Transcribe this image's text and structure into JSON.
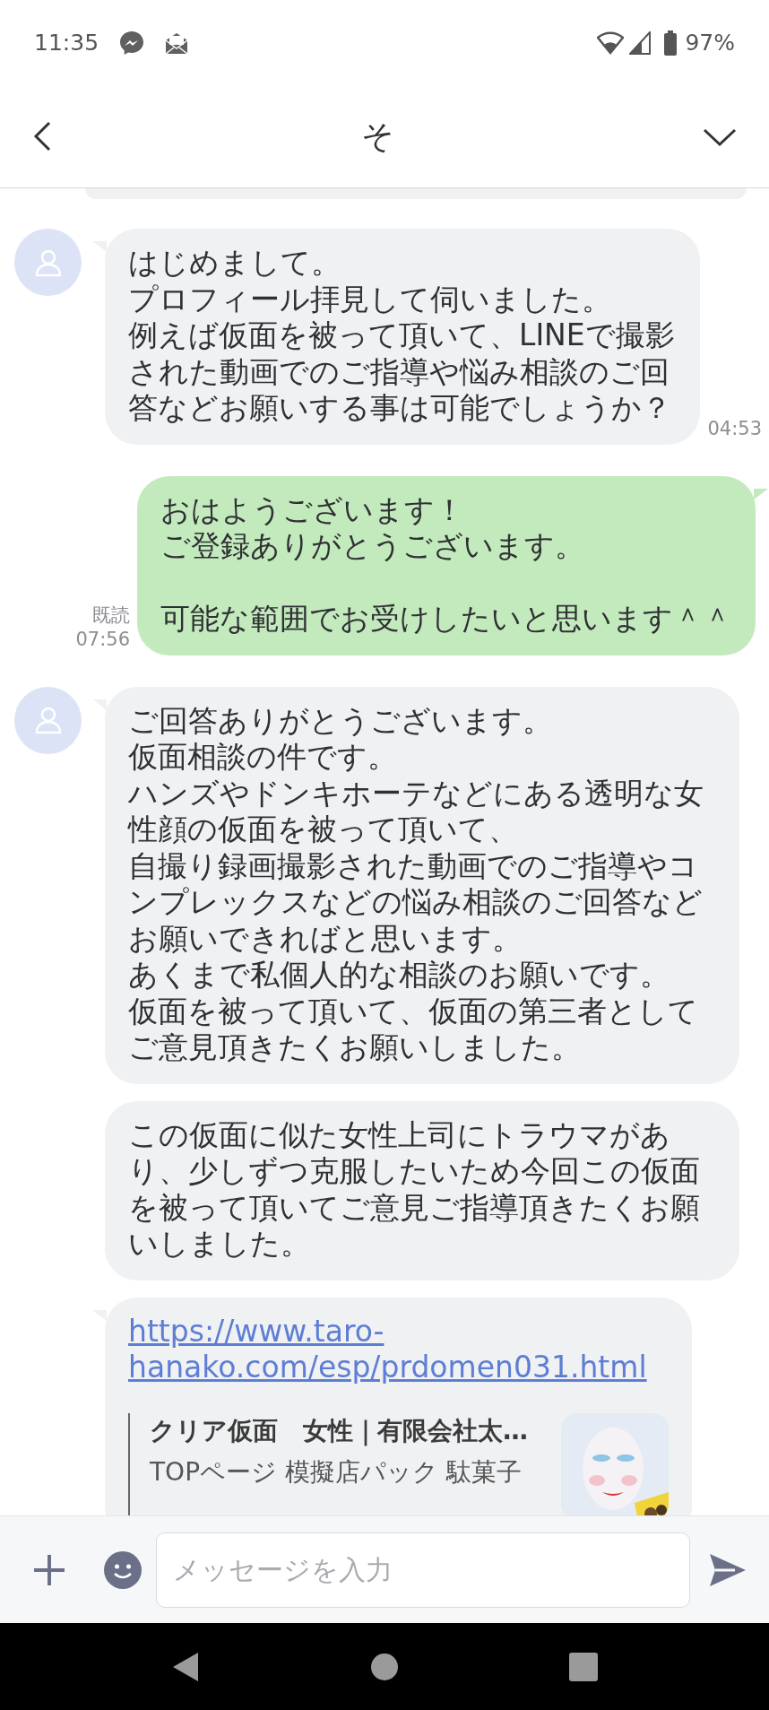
{
  "status_bar": {
    "time": "11:35",
    "battery": "97%"
  },
  "header": {
    "title": "そ"
  },
  "messages": [
    {
      "kind": "incoming",
      "show_avatar": true,
      "paragraphs": [
        [
          "はじめまして。",
          "プロフィール拝見して伺いました。",
          "例えば仮面を被って頂いて、LINEで撮影された動画でのご指導や悩み相談のご回答などお願いする事は可能でしょうか？"
        ]
      ],
      "time": "04:53"
    },
    {
      "kind": "outgoing",
      "paragraphs": [
        [
          "おはようございます！",
          "ご登録ありがとうございます。"
        ],
        [
          "可能な範囲でお受けしたいと思います＾＾"
        ]
      ],
      "read": "既読",
      "time": "07:56"
    },
    {
      "kind": "incoming",
      "show_avatar": true,
      "paragraphs": [
        [
          "ご回答ありがとうございます。",
          "仮面相談の件です。",
          "ハンズやドンキホーテなどにある透明な女性顔の仮面を被って頂いて、",
          "自撮り録画撮影された動画でのご指導やコンプレックスなどの悩み相談のご回答などお願いできればと思います。",
          "あくまで私個人的な相談のお願いです。",
          "仮面を被って頂いて、仮面の第三者としてご意見頂きたくお願いしました。"
        ]
      ]
    },
    {
      "kind": "incoming",
      "show_avatar": false,
      "paragraphs": [
        [
          "この仮面に似た女性上司にトラウマがあり、少しずつ克服したいため今回この仮面を被って頂いてご意見ご指導頂きたくお願いしました。"
        ]
      ]
    },
    {
      "kind": "link",
      "show_avatar": false,
      "url": "https://www.taro-hanako.com/esp/prdomen031.html",
      "preview_title": "クリア仮面　女性｜有限会社太…",
      "preview_text": "TOPページ 模擬店パック 駄菓子"
    }
  ],
  "composer": {
    "placeholder": "メッセージを入力"
  }
}
